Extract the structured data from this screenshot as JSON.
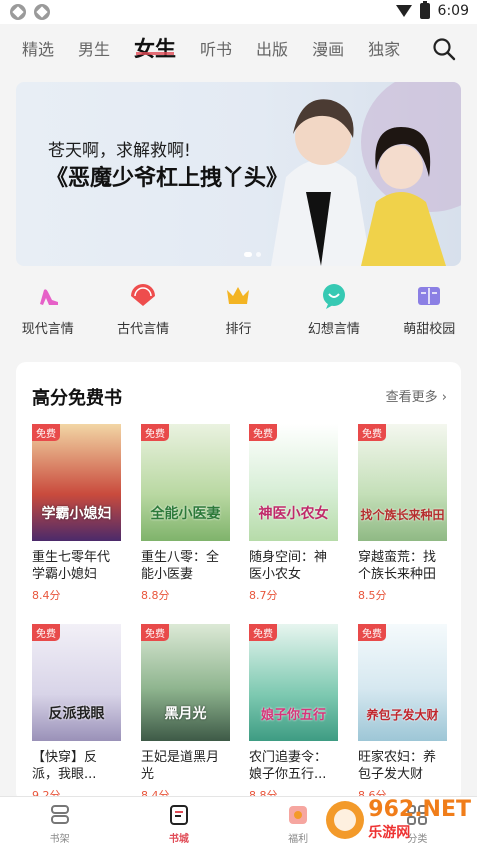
{
  "status_bar": {
    "time": "6:09"
  },
  "top_nav": {
    "tabs": [
      {
        "label": "精选"
      },
      {
        "label": "男生"
      },
      {
        "label": "女生"
      },
      {
        "label": "听书"
      },
      {
        "label": "出版"
      },
      {
        "label": "漫画"
      },
      {
        "label": "独家"
      }
    ],
    "active_tab": "女生"
  },
  "banner": {
    "line1": "苍天啊，求解救啊!",
    "line2": "《恶魔少爷杠上拽丫头》"
  },
  "categories": [
    {
      "label": "现代言情",
      "icon": "high-heel-icon",
      "color": "#e660c8"
    },
    {
      "label": "古代言情",
      "icon": "fan-icon",
      "color": "#ee4d4d"
    },
    {
      "label": "排行",
      "icon": "crown-icon",
      "color": "#f3b423"
    },
    {
      "label": "幻想言情",
      "icon": "chat-bubble-icon",
      "color": "#36c9b3"
    },
    {
      "label": "萌甜校园",
      "icon": "book-icon",
      "color": "#8b7fe4"
    }
  ],
  "section": {
    "title": "高分免费书",
    "more_label": "查看更多",
    "badge": "免费",
    "books": [
      {
        "title": "重生七零年代学霸小媳妇",
        "score": "8.4分",
        "cover_text": "学霸小媳妇",
        "cover_color": "#c94b3d"
      },
      {
        "title": "重生八零：全能小医妻",
        "score": "8.8分",
        "cover_text": "全能小医妻",
        "cover_color": "#b9d8a2"
      },
      {
        "title": "随身空间：神医小农女",
        "score": "8.7分",
        "cover_text": "神医小农女",
        "cover_color": "#d9efd8"
      },
      {
        "title": "穿越蛮荒：找个族长来种田",
        "score": "8.5分",
        "cover_text": "找个族长来种田",
        "cover_color": "#c4dfb8"
      },
      {
        "title": "【快穿】反派，我眼...",
        "score": "9.2分",
        "cover_text": "反派我眼",
        "cover_color": "#d8d4e8"
      },
      {
        "title": "王妃是道黑月光",
        "score": "8.4分",
        "cover_text": "黑月光",
        "cover_color": "#8fb58f"
      },
      {
        "title": "农门追妻令：娘子你五行...",
        "score": "8.8分",
        "cover_text": "娘子你五行",
        "cover_color": "#7ec9b1"
      },
      {
        "title": "旺家农妇：养包子发大财",
        "score": "8.6分",
        "cover_text": "养包子发大财",
        "cover_color": "#d6e8f0"
      }
    ]
  },
  "bottom_nav": [
    {
      "label": "书架",
      "icon": "bookshelf-icon"
    },
    {
      "label": "书城",
      "icon": "bookstore-icon"
    },
    {
      "label": "福利",
      "icon": "gift-icon"
    },
    {
      "label": "分类",
      "icon": "grid-icon"
    }
  ],
  "bottom_nav_active": "书城",
  "watermark": {
    "big": "962.NET",
    "small": "乐游网"
  },
  "colors": {
    "accent": "#e04b56",
    "score": "#e8563c",
    "badge": "#e84a4a"
  }
}
